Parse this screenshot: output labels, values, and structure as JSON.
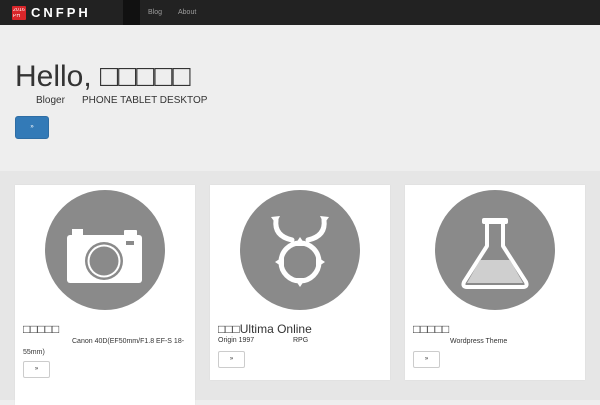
{
  "navbar": {
    "logo_top": "2016",
    "logo_bottom": "PH",
    "brand": "CNFPH",
    "links": [
      "Blog",
      "About"
    ]
  },
  "hero": {
    "title": "Hello, □□□□□",
    "tag_role": "Bloger",
    "tag_devices": "PHONE TABLET DESKTOP",
    "button_label": "»"
  },
  "cards": [
    {
      "title": "□□□□□",
      "desc": "Canon 40D(EF50mm/F1.8 EF-S 18-55mm)",
      "button_label": "»",
      "icon": "camera-icon"
    },
    {
      "title": "□□□Ultima Online",
      "meta_year": "Origin 1997",
      "meta_genre": "RPG",
      "button_label": "»",
      "icon": "ultima-ankh-icon"
    },
    {
      "title": "□□□□□",
      "desc": "Wordpress Theme",
      "button_label": "»",
      "icon": "flask-icon"
    }
  ],
  "colors": {
    "navbar": "#222222",
    "logo_red": "#d9262a",
    "primary": "#337ab7",
    "icon_circle": "#8a8a8a"
  }
}
